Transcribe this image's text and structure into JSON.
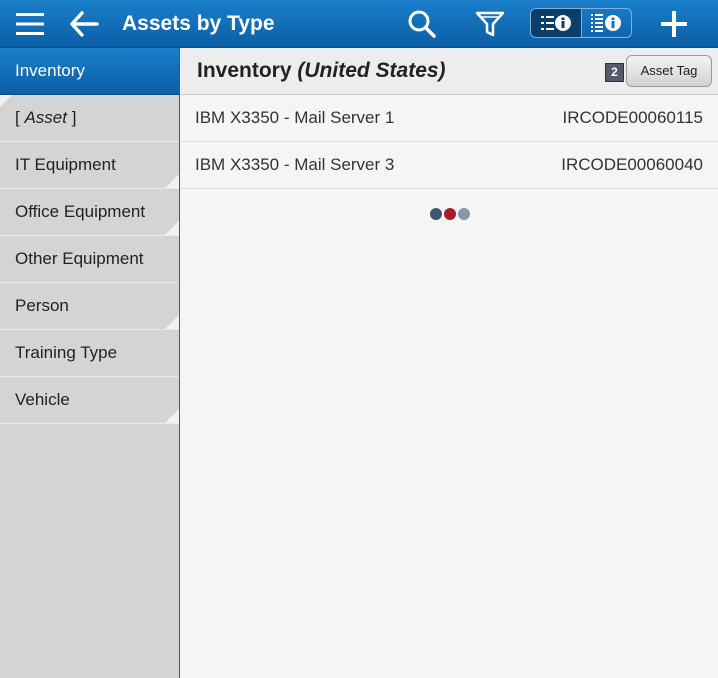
{
  "header": {
    "title": "Assets by Type",
    "menu_icon": "hamburger-menu-icon",
    "back_icon": "back-arrow-icon",
    "search_icon": "search-icon",
    "filter_icon": "filter-icon",
    "view_list_icon": "list-info-icon",
    "view_detail_icon": "detail-list-info-icon",
    "add_icon": "plus-icon",
    "accent": "#1273bf"
  },
  "sidebar": {
    "items": [
      {
        "label": "Inventory",
        "active": true
      },
      {
        "label": "Asset",
        "prefix": "[ ",
        "suffix": " ]"
      },
      {
        "label": "IT Equipment"
      },
      {
        "label": "Office Equipment"
      },
      {
        "label": "Other Equipment"
      },
      {
        "label": "Person"
      },
      {
        "label": "Training Type"
      },
      {
        "label": "Vehicle"
      }
    ]
  },
  "main": {
    "title": "Inventory",
    "subtitle": "(United States)",
    "count_badge": "2",
    "sort_button": "Asset Tag",
    "rows": [
      {
        "name": "IBM X3350 - Mail Server 1",
        "code": "IRCODE00060115"
      },
      {
        "name": "IBM X3350 - Mail Server 3",
        "code": "IRCODE00060040"
      }
    ],
    "loader_colors": [
      "#3e5670",
      "#a51d2d",
      "#8a96aa"
    ]
  }
}
